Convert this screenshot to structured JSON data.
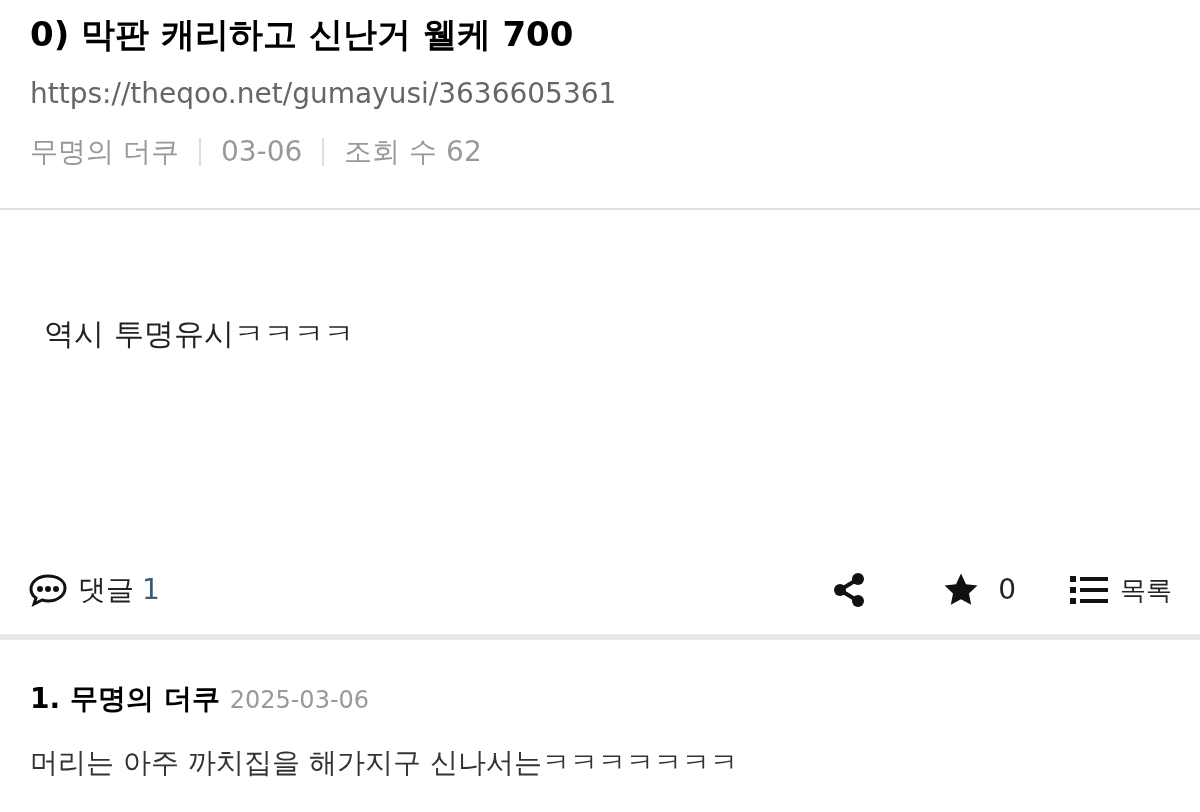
{
  "post": {
    "title": "0) 막판 캐리하고 신난거 웰케 700",
    "url": "https://theqoo.net/gumayusi/3636605361",
    "meta": [
      "무명의 더쿠",
      "03-06",
      "조회 수 62"
    ],
    "body": "역시 투명유시ㅋㅋㅋㅋ"
  },
  "actions": {
    "comments_label": "댓글",
    "comments_count": "1",
    "star_count": "0",
    "list_label": "목록"
  },
  "comments": [
    {
      "author": "1. 무명의 더쿠",
      "date": "2025-03-06",
      "text": "머리는 아주 까치집을 해가지구 신나서는ㅋㅋㅋㅋㅋㅋㅋ"
    }
  ]
}
